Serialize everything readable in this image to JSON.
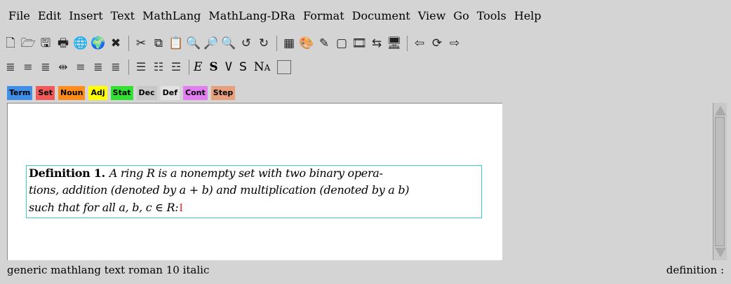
{
  "menu": [
    "File",
    "Edit",
    "Insert",
    "Text",
    "MathLang",
    "MathLang-DRa",
    "Format",
    "Document",
    "View",
    "Go",
    "Tools",
    "Help"
  ],
  "toolbar1": {
    "group1": [
      "new-file-icon",
      "open-folder-icon",
      "save-icon",
      "print-icon",
      "globe-icon",
      "web-icon",
      "close-x-icon"
    ],
    "group1_glyphs": [
      "🗋",
      "🗁",
      "🖫",
      "🖶",
      "🌐",
      "🌍",
      "✖"
    ],
    "group2": [
      "cut-icon",
      "copy-icon",
      "paste-icon",
      "find-icon",
      "replace-icon",
      "find-next-icon",
      "undo-icon",
      "redo-icon"
    ],
    "group2_glyphs": [
      "✂",
      "⧉",
      "📋",
      "🔍",
      "🔎",
      "🔍",
      "↺",
      "↻"
    ],
    "group3": [
      "table-icon",
      "image-icon",
      "draw-icon",
      "frame-icon",
      "film-icon",
      "link-icon",
      "screen-icon"
    ],
    "group3_glyphs": [
      "▦",
      "🎨",
      "✎",
      "▢",
      "🎞",
      "⇆",
      "🖥"
    ],
    "group4": [
      "back-arrow-icon",
      "refresh-icon",
      "forward-arrow-icon"
    ],
    "group4_glyphs": [
      "⇦",
      "⟳",
      "⇨"
    ]
  },
  "toolbar2": {
    "align": [
      "align-left-icon",
      "align-center-icon",
      "align-justify-icon",
      "align-indent-icon",
      "align-right-block-icon",
      "align-bottom-icon",
      "align-right-icon"
    ],
    "align_glyphs": [
      "≣",
      "≡",
      "≣",
      "⇹",
      "≡",
      "≣",
      "≣"
    ],
    "lists": [
      "bullet-list-icon",
      "numbered-list-icon",
      "description-list-icon"
    ],
    "lists_glyphs": [
      "☰",
      "☷",
      "☲"
    ],
    "styles": [
      "E",
      "S",
      "V",
      "S",
      "Na"
    ]
  },
  "tags": [
    {
      "label": "Term",
      "color": "#3f8fe8"
    },
    {
      "label": "Set",
      "color": "#f25a5a"
    },
    {
      "label": "Noun",
      "color": "#ff8c1a"
    },
    {
      "label": "Adj",
      "color": "#ffff00"
    },
    {
      "label": "Stat",
      "color": "#32e032"
    },
    {
      "label": "Dec",
      "color": "#c8c8c8"
    },
    {
      "label": "Def",
      "color": "#e2e2e2"
    },
    {
      "label": "Cont",
      "color": "#e27ef0"
    },
    {
      "label": "Step",
      "color": "#e8a07c"
    }
  ],
  "document": {
    "label": "Definition 1.",
    "line1": "A ring R is a nonempty set with two binary opera-",
    "line2": "tions, addition (denoted by a + b) and multiplication (denoted by a b)",
    "line3": "such that for all a, b, c ∈ R:",
    "cursor": "I"
  },
  "status": {
    "left": "generic mathlang text roman 10 italic",
    "right": "definition :"
  }
}
